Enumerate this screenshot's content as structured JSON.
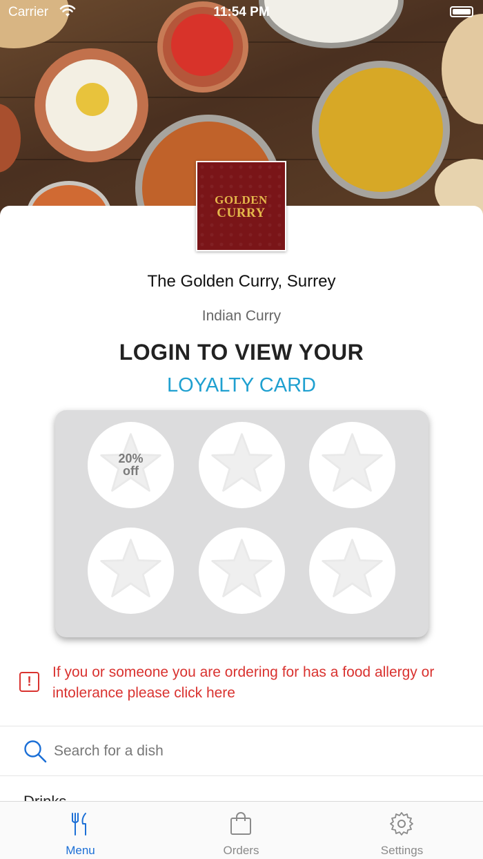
{
  "status_bar": {
    "carrier": "Carrier",
    "time": "11:54 PM"
  },
  "restaurant": {
    "logo_line1": "GOLDEN",
    "logo_line2": "CURRY",
    "name": "The Golden Curry, Surrey",
    "cuisine": "Indian Curry"
  },
  "loyalty": {
    "heading_line1": "LOGIN TO VIEW YOUR",
    "heading_line2": "LOYALTY CARD",
    "reward_line1": "20%",
    "reward_line2": "off",
    "stamps_total": 6
  },
  "allergy": {
    "icon": "exclamation-icon",
    "text": "If you or someone you are ordering for has a food allergy or intolerance please click here"
  },
  "search": {
    "placeholder": "Search for a dish",
    "value": ""
  },
  "menu": {
    "first_category": "Drinks"
  },
  "tabbar": {
    "tabs": [
      {
        "label": "Menu",
        "icon": "fork-knife-icon",
        "active": true
      },
      {
        "label": "Orders",
        "icon": "shopping-bag-icon",
        "active": false
      },
      {
        "label": "Settings",
        "icon": "gear-icon",
        "active": false
      }
    ]
  },
  "colors": {
    "accent_blue": "#1b6fd6",
    "loyalty_blue": "#1fa0d0",
    "alert_red": "#d9322f",
    "card_grey": "#dcdcdd",
    "logo_red": "#7a1518",
    "logo_gold": "#e5b84b"
  }
}
